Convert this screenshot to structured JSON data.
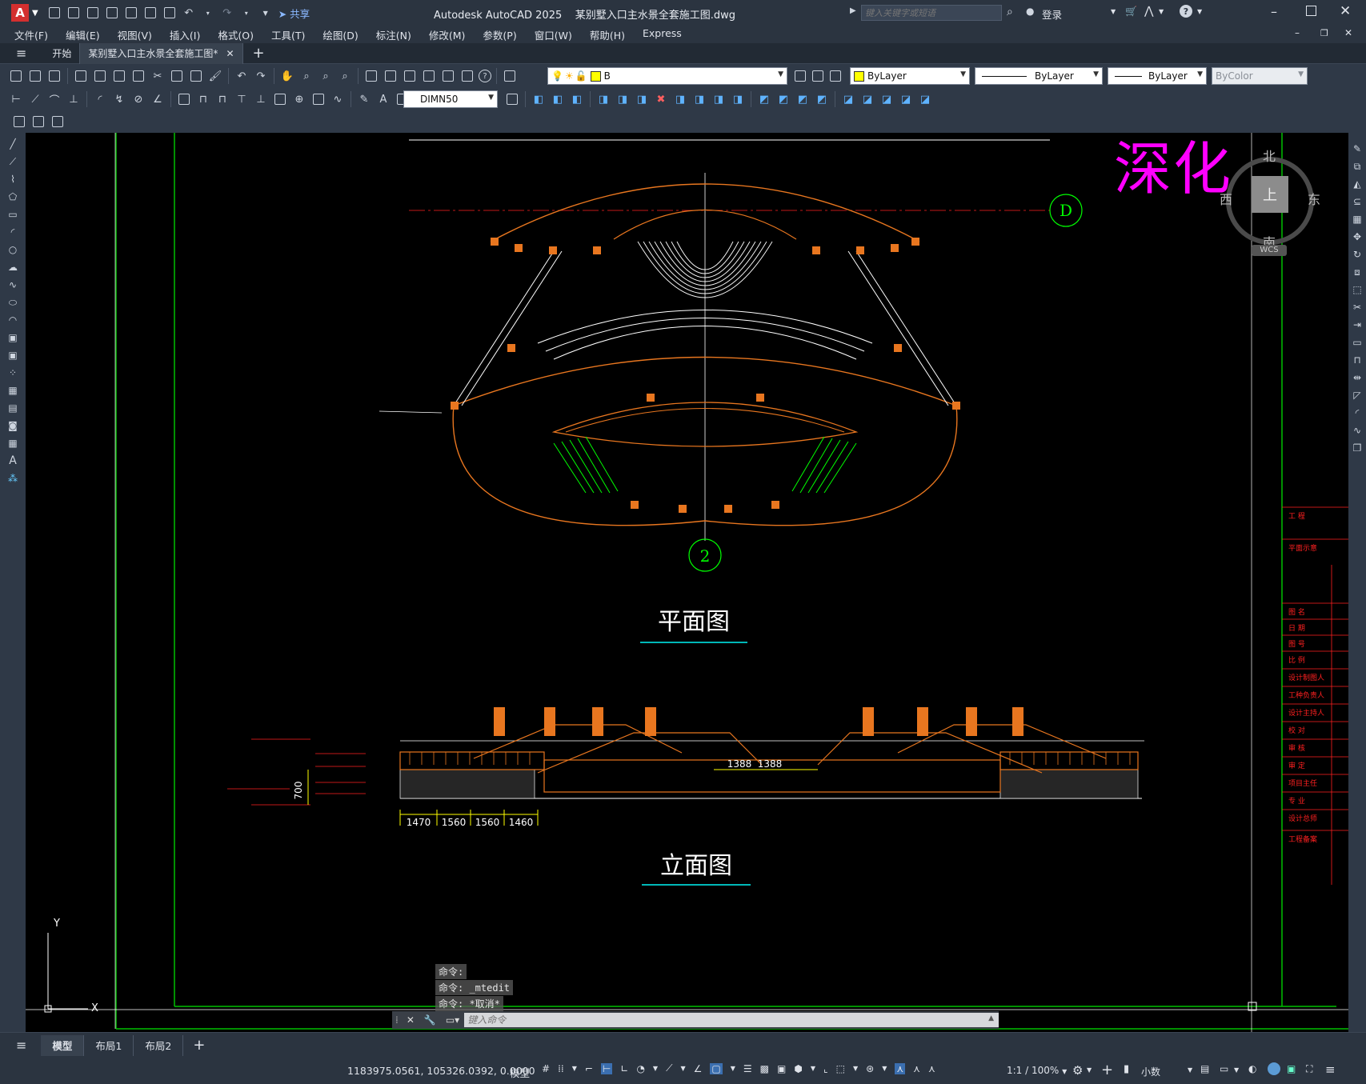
{
  "title_bar": {
    "app_badge": "A",
    "share": "共享",
    "title": "Autodesk AutoCAD 2025    某别墅入口主水景全套施工图.dwg",
    "search_placeholder": "键入关键字或短语",
    "login": "登录"
  },
  "menu": [
    "文件(F)",
    "编辑(E)",
    "视图(V)",
    "插入(I)",
    "格式(O)",
    "工具(T)",
    "绘图(D)",
    "标注(N)",
    "修改(M)",
    "参数(P)",
    "窗口(W)",
    "帮助(H)",
    "Express"
  ],
  "file_tabs": {
    "start": "开始",
    "active": "某别墅入口主水景全套施工图*"
  },
  "properties": {
    "layer": "B",
    "color": "ByLayer",
    "linetype": "ByLayer",
    "lineweight": "ByLayer",
    "plotstyle": "ByColor",
    "dimstyle": "DIMN50"
  },
  "viewcube": {
    "north": "北",
    "south": "南",
    "west": "西",
    "east": "东",
    "top": "上",
    "wcs": "WCS"
  },
  "overlay_text": "深化",
  "drawing": {
    "plan_title": "平面图",
    "elevation_title": "立面图",
    "axis_d": "D",
    "axis_2": "2",
    "dims_bottom": [
      "1470",
      "1560",
      "1560",
      "1460"
    ],
    "dim_700": "700",
    "dims_mid": [
      "1388",
      "1388"
    ],
    "titleblock": [
      "工 程",
      "平面示意",
      "图 名",
      "日 期",
      "图 号",
      "比 例",
      "设计制图人",
      "工种负责人",
      "设计主持人",
      "校 对",
      "审 核",
      "审 定",
      "项目主任",
      "专 业",
      "设计总师",
      "工程备案"
    ]
  },
  "command": {
    "history": [
      "命令:",
      "命令: _mtedit",
      "命令: *取消*"
    ],
    "placeholder": "键入命令"
  },
  "layout_tabs": [
    "模型",
    "布局1",
    "布局2"
  ],
  "status": {
    "coords": "1183975.0561, 105326.0392, 0.0000",
    "mode": "模型",
    "scale": "1:1 / 100%",
    "units": "小数"
  },
  "colors": {
    "accent": "#ff00ff",
    "orange": "#e8761f",
    "green": "#00ff00",
    "red": "#ff2020"
  }
}
